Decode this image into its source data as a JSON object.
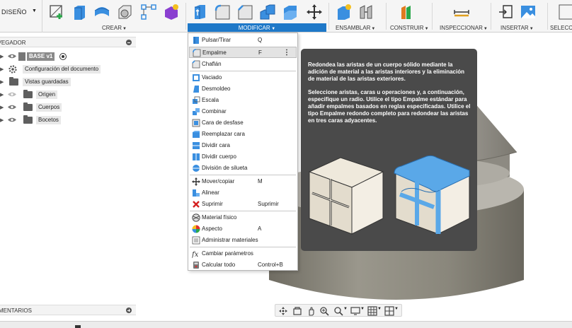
{
  "toolbar": {
    "workspace_label": "DISEÑO",
    "groups": {
      "crear": "CREAR",
      "modificar": "MODIFICAR",
      "ensamblar": "ENSAMBLAR",
      "construir": "CONSTRUIR",
      "inspeccionar": "INSPECCIONAR",
      "insertar": "INSERTAR",
      "seleccionar": "SELECC"
    },
    "accent_color": "#1e78c8"
  },
  "browser": {
    "title": "NAVEGADOR",
    "items": [
      {
        "label": "BASE v1"
      },
      {
        "label": "Configuración del documento"
      },
      {
        "label": "Vistas guardadas"
      },
      {
        "label": "Origen"
      },
      {
        "label": "Cuerpos"
      },
      {
        "label": "Bocetos"
      }
    ]
  },
  "menu": {
    "items": [
      {
        "label": "Pulsar/Tirar",
        "shortcut": "Q"
      },
      {
        "label": "Empalme",
        "shortcut": "F"
      },
      {
        "label": "Chaflán",
        "shortcut": ""
      },
      {
        "label": "Vaciado",
        "shortcut": ""
      },
      {
        "label": "Desmoldeo",
        "shortcut": ""
      },
      {
        "label": "Escala",
        "shortcut": ""
      },
      {
        "label": "Combinar",
        "shortcut": ""
      },
      {
        "label": "Cara de desfase",
        "shortcut": ""
      },
      {
        "label": "Reemplazar cara",
        "shortcut": ""
      },
      {
        "label": "Dividir cara",
        "shortcut": ""
      },
      {
        "label": "Dividir cuerpo",
        "shortcut": ""
      },
      {
        "label": "División de silueta",
        "shortcut": ""
      },
      {
        "label": "Mover/copiar",
        "shortcut": "M"
      },
      {
        "label": "Alinear",
        "shortcut": ""
      },
      {
        "label": "Suprimir",
        "shortcut": "Suprimir"
      },
      {
        "label": "Material físico",
        "shortcut": ""
      },
      {
        "label": "Aspecto",
        "shortcut": "A"
      },
      {
        "label": "Administrar materiales",
        "shortcut": ""
      },
      {
        "label": "Cambiar parámetros",
        "shortcut": ""
      },
      {
        "label": "Calcular todo",
        "shortcut": "Control+B"
      }
    ],
    "more_label": "⋮"
  },
  "tooltip": {
    "paragraph1": "Redondea las aristas de un cuerpo sólido mediante la adición de material a las aristas interiores y la eliminación de material de las aristas exteriores.",
    "paragraph2": "Seleccione aristas, caras u operaciones y, a continuación, especifique un radio. Utilice el tipo Empalme estándar para añadir empalmes basados en reglas especificadas. Utilice el tipo Empalme redondo completo para redondear las aristas en tres caras adyacentes."
  },
  "comments": {
    "title": "COMENTARIOS"
  }
}
